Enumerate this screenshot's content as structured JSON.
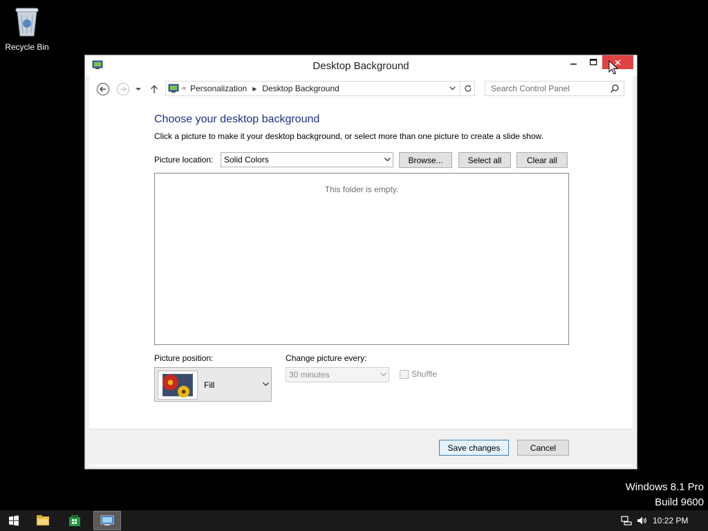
{
  "desktop": {
    "recycle_bin_label": "Recycle Bin",
    "watermark_line1": "Windows 8.1 Pro",
    "watermark_line2": "Build 9600"
  },
  "window": {
    "title": "Desktop Background",
    "buttons": {
      "minimize": "minimize-icon",
      "maximize": "maximize-icon",
      "close": "close-icon"
    },
    "close_color": "#e04343"
  },
  "nav": {
    "breadcrumb_prefix": "«",
    "breadcrumbs": [
      "Personalization",
      "Desktop Background"
    ],
    "search_placeholder": "Search Control Panel"
  },
  "main": {
    "heading": "Choose your desktop background",
    "subtext": "Click a picture to make it your desktop background, or select more than one picture to create a slide show.",
    "picture_location_label": "Picture location:",
    "picture_location_value": "Solid Colors",
    "browse_label": "Browse...",
    "select_all_label": "Select all",
    "clear_all_label": "Clear all",
    "empty_message": "This folder is empty.",
    "picture_position_label": "Picture position:",
    "picture_position_value": "Fill",
    "change_picture_label": "Change picture every:",
    "change_picture_value": "30 minutes",
    "shuffle_label": "Shuffle",
    "shuffle_checked": false
  },
  "footer": {
    "save_label": "Save changes",
    "cancel_label": "Cancel"
  },
  "taskbar": {
    "clock": "10:22 PM",
    "items": [
      "start-icon",
      "file-explorer-icon",
      "store-icon",
      "control-panel-icon"
    ]
  },
  "colors": {
    "heading": "#1e3287",
    "desktop": "#000000",
    "taskbar": "#1a1a1a"
  }
}
